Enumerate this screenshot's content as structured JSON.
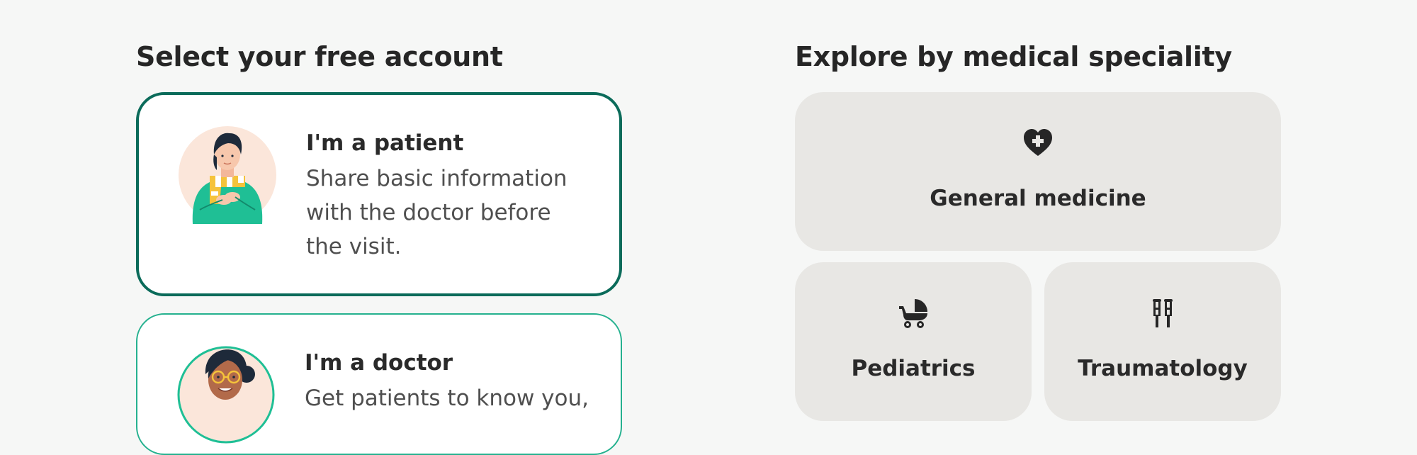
{
  "accounts": {
    "heading": "Select your free account",
    "patient": {
      "title": "I'm a patient",
      "description": "Share basic information with the doctor before the visit.",
      "selected": true,
      "border_color": "#0b6b5a"
    },
    "doctor": {
      "title": "I'm a doctor",
      "description": "Get patients to know you,",
      "selected": false,
      "border_color": "#25b18f"
    }
  },
  "specialities": {
    "heading": "Explore by medical speciality",
    "tile_color": "#e8e7e4",
    "items": [
      {
        "label": "General medicine",
        "icon": "heart-plus-icon"
      },
      {
        "label": "Pediatrics",
        "icon": "baby-stroller-icon"
      },
      {
        "label": "Traumatology",
        "icon": "crutches-icon"
      }
    ]
  },
  "colors": {
    "background": "#f6f7f6",
    "brand_dark_green": "#0b6b5a",
    "brand_green": "#1fbf95",
    "text": "#2a2a2a"
  }
}
